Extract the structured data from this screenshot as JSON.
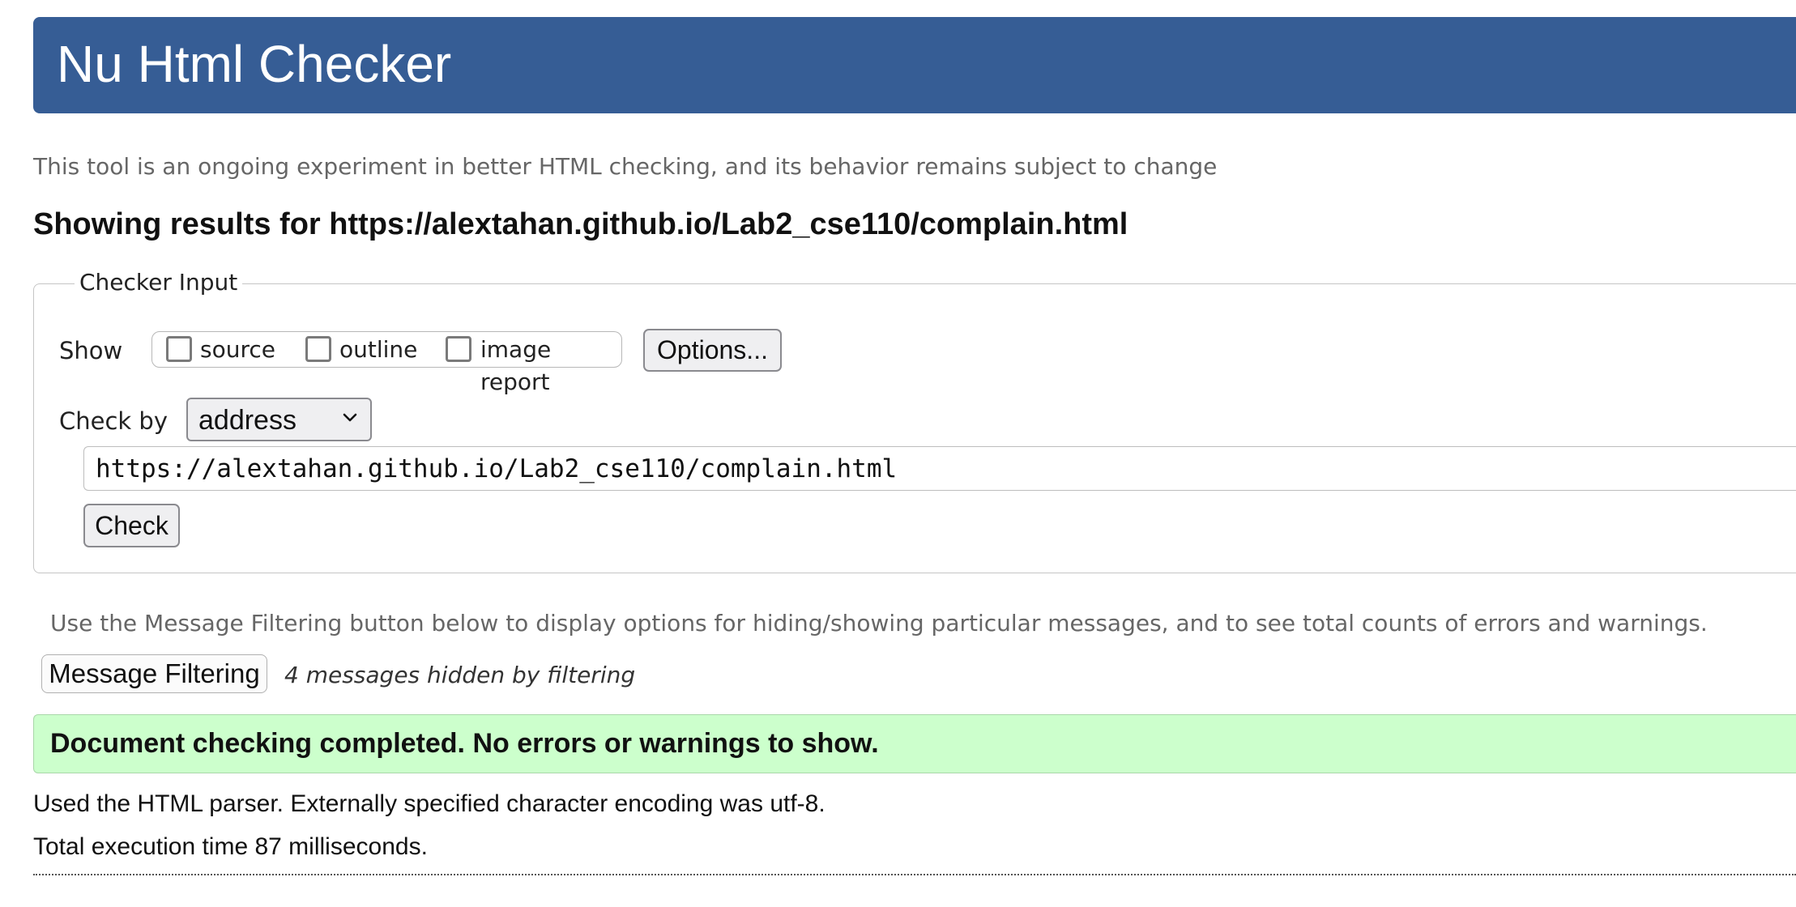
{
  "header": {
    "title": "Nu Html Checker"
  },
  "tagline": "This tool is an ongoing experiment in better HTML checking, and its behavior remains subject to change",
  "results_heading": "Showing results for https://alextahan.github.io/Lab2_cse110/complain.html",
  "checker_input": {
    "legend": "Checker Input",
    "show_label": "Show",
    "options": [
      {
        "label": "source",
        "checked": false
      },
      {
        "label": "outline",
        "checked": false
      },
      {
        "label": "image report",
        "checked": false
      }
    ],
    "options_button": "Options...",
    "check_by_label": "Check by",
    "check_by_value": "address",
    "url_value": "https://alextahan.github.io/Lab2_cse110/complain.html",
    "check_button": "Check"
  },
  "filtering": {
    "info": "Use the Message Filtering button below to display options for hiding/showing particular messages, and to see total counts of errors and warnings.",
    "button": "Message Filtering",
    "hidden_count": "4 messages hidden by filtering"
  },
  "result": {
    "success_message": "Document checking completed. No errors or warnings to show.",
    "parser_info": "Used the HTML parser. Externally specified character encoding was utf-8.",
    "execution_time": "Total execution time 87 milliseconds."
  },
  "colors": {
    "banner": "#365d95",
    "success_bg": "#ccffcc",
    "muted_text": "#666666"
  },
  "icons": {
    "select_arrow": "chevron-down-icon"
  }
}
